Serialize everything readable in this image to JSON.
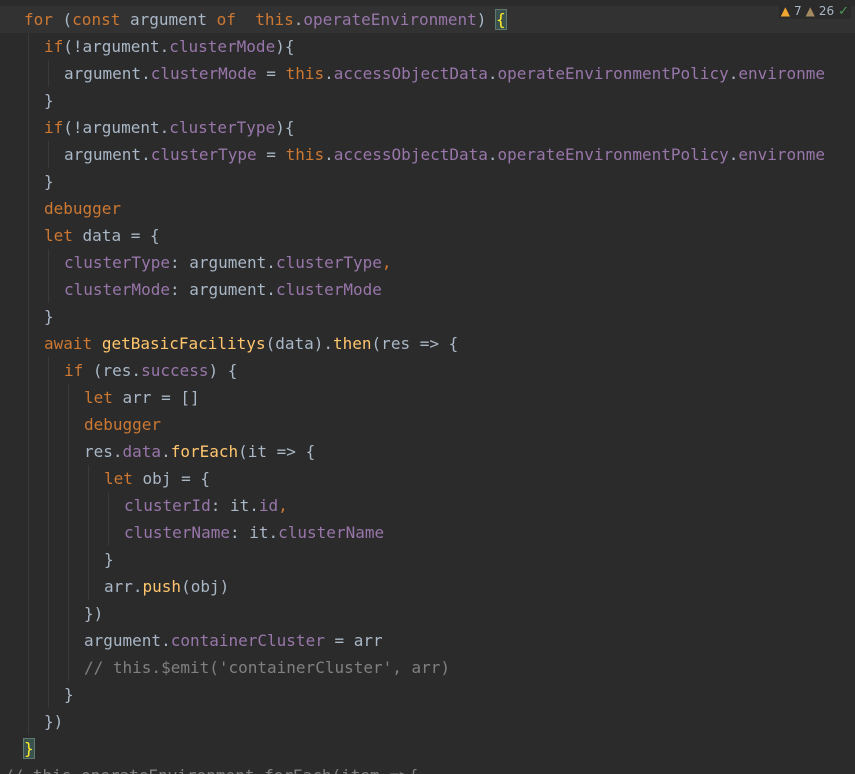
{
  "inspections": {
    "warnings": "7",
    "weak_warnings": "26"
  },
  "colors": {
    "background": "#2b2b2b",
    "keyword": "#cc7832",
    "property": "#9876aa",
    "function": "#ffc66d",
    "comment": "#808080",
    "text": "#a9b7c6"
  },
  "code": {
    "lines": [
      [
        [
          "kw",
          "for"
        ],
        [
          "pl",
          " ("
        ],
        [
          "kw",
          "const"
        ],
        [
          "pl",
          " argument "
        ],
        [
          "kw",
          "of"
        ],
        [
          "pl",
          "  "
        ],
        [
          "kw",
          "this"
        ],
        [
          "pl",
          "."
        ],
        [
          "prop",
          "operateEnvironment"
        ],
        [
          "pl",
          ") "
        ],
        [
          "brace",
          "{"
        ]
      ],
      [
        [
          "kw",
          "if"
        ],
        [
          "pl",
          "(!argument."
        ],
        [
          "prop",
          "clusterMode"
        ],
        [
          "pl",
          "){"
        ]
      ],
      [
        [
          "pl",
          "argument."
        ],
        [
          "prop",
          "clusterMode"
        ],
        [
          "pl",
          " = "
        ],
        [
          "kw",
          "this"
        ],
        [
          "pl",
          "."
        ],
        [
          "prop",
          "accessObjectData"
        ],
        [
          "pl",
          "."
        ],
        [
          "prop",
          "operateEnvironmentPolicy"
        ],
        [
          "pl",
          "."
        ],
        [
          "prop",
          "environme"
        ]
      ],
      [
        [
          "pl",
          "}"
        ]
      ],
      [
        [
          "kw",
          "if"
        ],
        [
          "pl",
          "(!argument."
        ],
        [
          "prop",
          "clusterType"
        ],
        [
          "pl",
          "){"
        ]
      ],
      [
        [
          "pl",
          "argument."
        ],
        [
          "prop",
          "clusterType"
        ],
        [
          "pl",
          " = "
        ],
        [
          "kw",
          "this"
        ],
        [
          "pl",
          "."
        ],
        [
          "prop",
          "accessObjectData"
        ],
        [
          "pl",
          "."
        ],
        [
          "prop",
          "operateEnvironmentPolicy"
        ],
        [
          "pl",
          "."
        ],
        [
          "prop",
          "environme"
        ]
      ],
      [
        [
          "pl",
          "}"
        ]
      ],
      [
        [
          "kw",
          "debugger"
        ]
      ],
      [
        [
          "kw",
          "let"
        ],
        [
          "pl",
          " data = {"
        ]
      ],
      [
        [
          "prop",
          "clusterType"
        ],
        [
          "pl",
          ": argument."
        ],
        [
          "prop",
          "clusterType"
        ],
        [
          "kw",
          ","
        ]
      ],
      [
        [
          "prop",
          "clusterMode"
        ],
        [
          "pl",
          ": argument."
        ],
        [
          "prop",
          "clusterMode"
        ]
      ],
      [
        [
          "pl",
          "}"
        ]
      ],
      [
        [
          "kw",
          "await"
        ],
        [
          "pl",
          " "
        ],
        [
          "fn",
          "getBasicFacilitys"
        ],
        [
          "pl",
          "(data)."
        ],
        [
          "fn",
          "then"
        ],
        [
          "pl",
          "(res => {"
        ]
      ],
      [
        [
          "kw",
          "if"
        ],
        [
          "pl",
          " (res."
        ],
        [
          "prop",
          "success"
        ],
        [
          "pl",
          ") {"
        ]
      ],
      [
        [
          "kw",
          "let"
        ],
        [
          "pl",
          " arr = []"
        ]
      ],
      [
        [
          "kw",
          "debugger"
        ]
      ],
      [
        [
          "pl",
          "res."
        ],
        [
          "prop",
          "data"
        ],
        [
          "pl",
          "."
        ],
        [
          "fn",
          "forEach"
        ],
        [
          "pl",
          "(it => {"
        ]
      ],
      [
        [
          "kw",
          "let"
        ],
        [
          "pl",
          " obj = {"
        ]
      ],
      [
        [
          "prop",
          "clusterId"
        ],
        [
          "pl",
          ": it."
        ],
        [
          "prop",
          "id"
        ],
        [
          "kw",
          ","
        ]
      ],
      [
        [
          "prop",
          "clusterName"
        ],
        [
          "pl",
          ": it."
        ],
        [
          "prop",
          "clusterName"
        ]
      ],
      [
        [
          "pl",
          "}"
        ]
      ],
      [
        [
          "pl",
          "arr."
        ],
        [
          "fn",
          "push"
        ],
        [
          "pl",
          "(obj)"
        ]
      ],
      [
        [
          "pl",
          "})"
        ]
      ],
      [
        [
          "pl",
          "argument."
        ],
        [
          "prop",
          "containerCluster"
        ],
        [
          "pl",
          " = arr"
        ]
      ],
      [
        [
          "cm",
          "// this.$emit('containerCluster', arr)"
        ]
      ],
      [
        [
          "pl",
          "}"
        ]
      ],
      [
        [
          "pl",
          "})"
        ]
      ],
      [
        [
          "brace",
          "}"
        ]
      ],
      [
        [
          "cm",
          "// this.operateEnvironment.forEach(item =>{"
        ]
      ]
    ]
  }
}
